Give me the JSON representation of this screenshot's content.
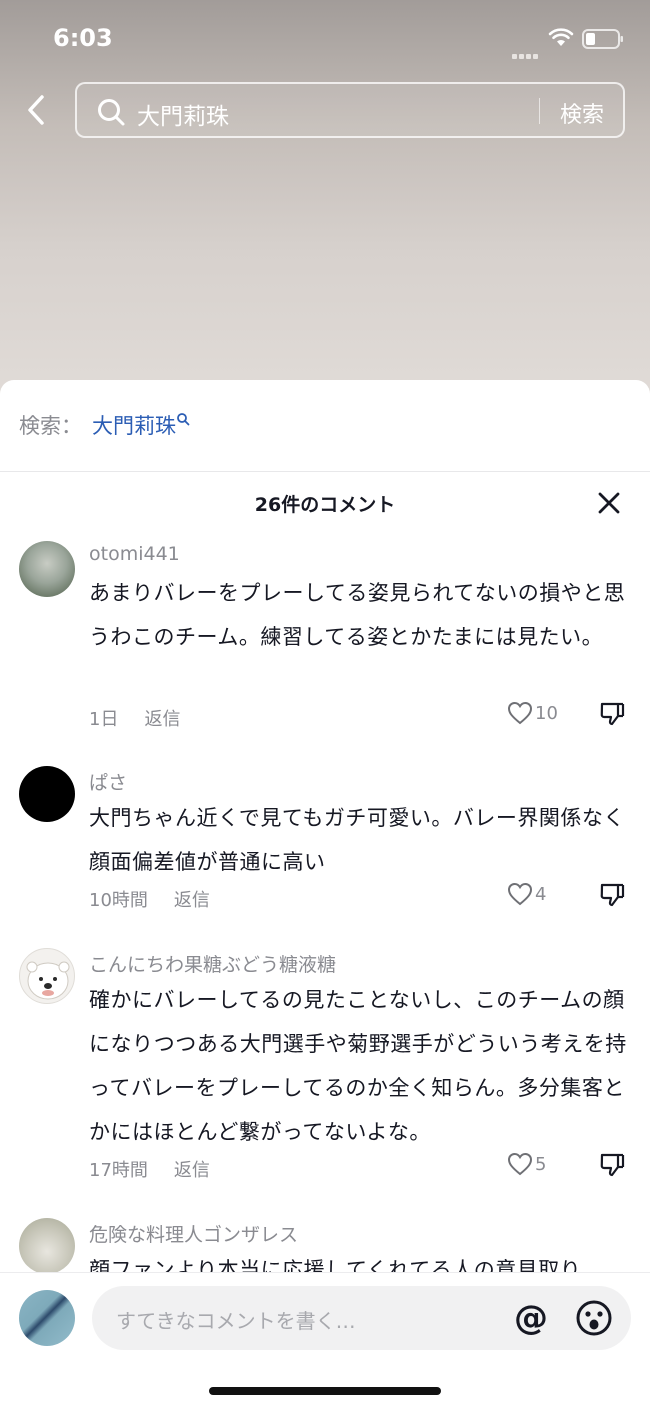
{
  "status_bar": {
    "time": "6:03"
  },
  "search": {
    "query": "大門莉珠",
    "submit_label": "検索"
  },
  "suggestion": {
    "prefix": "検索：",
    "link": "大門莉珠"
  },
  "comments_header": {
    "count_label": "26件のコメント"
  },
  "comments": [
    {
      "username": "otomi441",
      "text": "あまりバレーをプレーしてる姿見られてないの損やと思うわこのチーム。練習してる姿とかたまには見たい。",
      "time": "1日",
      "reply": "返信",
      "likes": "10",
      "avatar": "landscape-photo"
    },
    {
      "username": "ぱさ",
      "text": "大門ちゃん近くで見てもガチ可愛い。バレー界関係なく顔面偏差値が普通に高い",
      "time": "10時間",
      "reply": "返信",
      "likes": "4",
      "avatar": "black-circle"
    },
    {
      "username": "こんにちわ果糖ぶどう糖液糖",
      "text": "確かにバレーしてるの見たことないし、このチームの顔になりつつある大門選手や菊野選手がどういう考えを持ってバレーをプレーしてるのか全く知らん。多分集客とかにはほとんど繋がってないよな。",
      "time": "17時間",
      "reply": "返信",
      "likes": "5",
      "avatar": "polar-bear"
    },
    {
      "username": "危険な料理人ゴンザレス",
      "text": "顔ファンより本当に応援してくれてる人の意見取り",
      "avatar": "birds-photo"
    }
  ],
  "composer": {
    "placeholder": "すてきなコメントを書く…",
    "at_symbol": "@"
  },
  "icons": {
    "back": "chevron-left-icon",
    "search": "search-icon",
    "close": "close-icon",
    "like": "heart-outline-icon",
    "dislike": "thumbs-down-icon",
    "emoji": "emoji-icon"
  },
  "colors": {
    "link": "#2b5db4",
    "secondary_text": "#8a8b91",
    "primary_text": "#161823"
  }
}
